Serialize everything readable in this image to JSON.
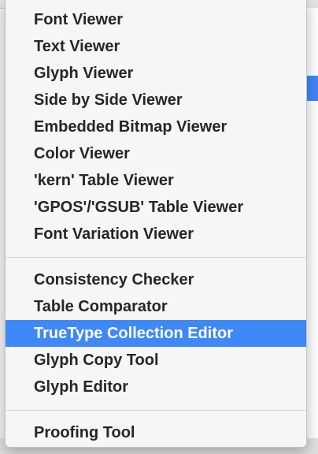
{
  "menu": {
    "group1": [
      {
        "label": "Font Viewer"
      },
      {
        "label": "Text Viewer"
      },
      {
        "label": "Glyph Viewer"
      },
      {
        "label": "Side by Side Viewer"
      },
      {
        "label": "Embedded Bitmap Viewer"
      },
      {
        "label": "Color Viewer"
      },
      {
        "label": "'kern' Table Viewer"
      },
      {
        "label": "'GPOS'/'GSUB' Table Viewer"
      },
      {
        "label": "Font Variation Viewer"
      }
    ],
    "group2": [
      {
        "label": "Consistency Checker"
      },
      {
        "label": "Table Comparator"
      },
      {
        "label": "TrueType Collection Editor"
      },
      {
        "label": "Glyph Copy Tool"
      },
      {
        "label": "Glyph Editor"
      }
    ],
    "group3": [
      {
        "label": "Proofing Tool"
      }
    ],
    "highlighted_item": "TrueType Collection Editor",
    "highlight_color": "#3f88f8"
  }
}
